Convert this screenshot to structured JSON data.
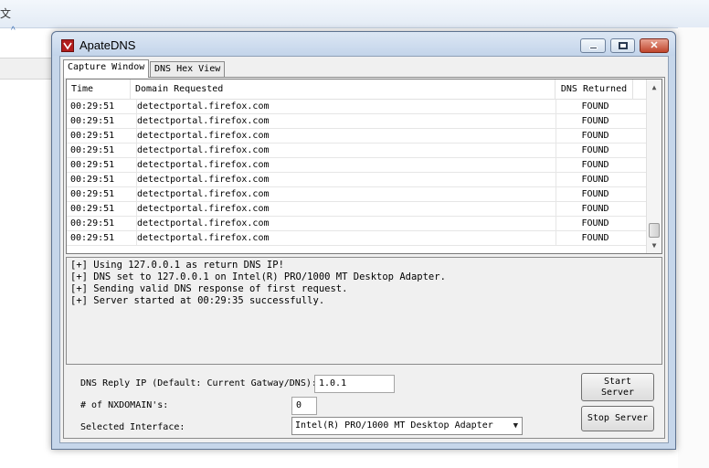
{
  "background": {
    "glyph": "文",
    "chevron": "^"
  },
  "window": {
    "title": "ApateDNS",
    "controls": {
      "minimize": "",
      "maximize": "",
      "close": "✕"
    }
  },
  "tabs": [
    {
      "label": "Capture Window",
      "active": true
    },
    {
      "label": "DNS Hex View",
      "active": false
    }
  ],
  "table": {
    "columns": [
      "Time",
      "Domain Requested",
      "DNS Returned"
    ],
    "rows": [
      [
        "00:29:51",
        "detectportal.firefox.com",
        "FOUND"
      ],
      [
        "00:29:51",
        "detectportal.firefox.com",
        "FOUND"
      ],
      [
        "00:29:51",
        "detectportal.firefox.com",
        "FOUND"
      ],
      [
        "00:29:51",
        "detectportal.firefox.com",
        "FOUND"
      ],
      [
        "00:29:51",
        "detectportal.firefox.com",
        "FOUND"
      ],
      [
        "00:29:51",
        "detectportal.firefox.com",
        "FOUND"
      ],
      [
        "00:29:51",
        "detectportal.firefox.com",
        "FOUND"
      ],
      [
        "00:29:51",
        "detectportal.firefox.com",
        "FOUND"
      ],
      [
        "00:29:51",
        "detectportal.firefox.com",
        "FOUND"
      ],
      [
        "00:29:51",
        "detectportal.firefox.com",
        "FOUND"
      ]
    ],
    "scroll": {
      "up": "▲",
      "down": "▼"
    }
  },
  "log": [
    "[+] Using 127.0.0.1 as return DNS IP!",
    "[+] DNS set to 127.0.0.1 on Intel(R) PRO/1000 MT Desktop Adapter.",
    "[+] Sending valid DNS response of first request.",
    "[+] Server started at 00:29:35 successfully."
  ],
  "form": {
    "reply_ip_label": "DNS Reply IP (Default: Current Gatway/DNS):",
    "reply_ip_value": "1.0.1",
    "nxdomain_label": "# of NXDOMAIN's:",
    "nxdomain_value": "0",
    "interface_label": "Selected Interface:",
    "interface_value": "Intel(R) PRO/1000 MT Desktop Adapter",
    "dropdown_arrow": "▼"
  },
  "buttons": {
    "start_line1": "Start",
    "start_line2": "Server",
    "stop": "Stop Server"
  }
}
